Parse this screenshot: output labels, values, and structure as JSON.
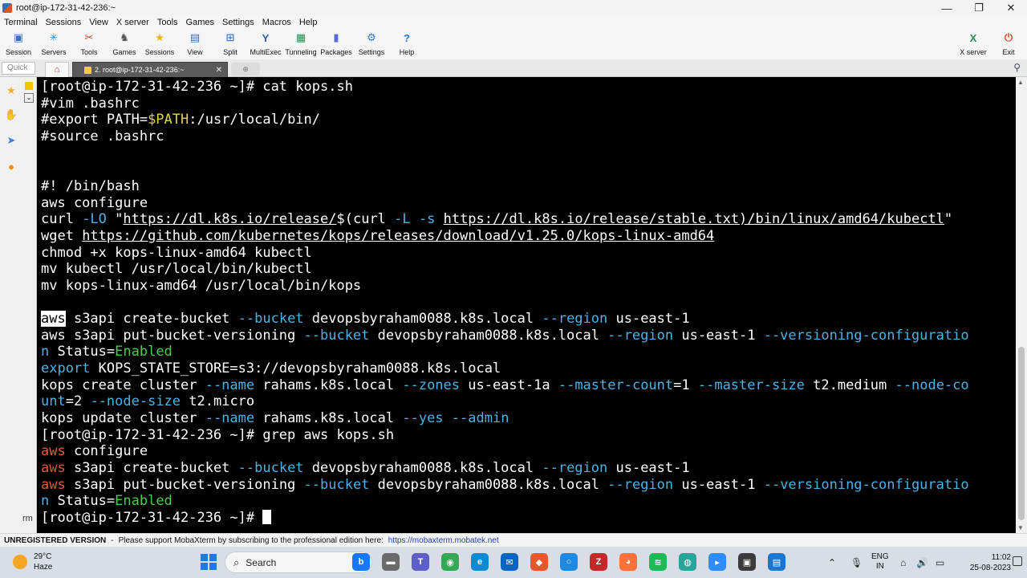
{
  "window": {
    "title": "root@ip-172-31-42-236:~",
    "controls": [
      "—",
      "❐",
      "✕"
    ]
  },
  "menu": [
    "Terminal",
    "Sessions",
    "View",
    "X server",
    "Tools",
    "Games",
    "Settings",
    "Macros",
    "Help"
  ],
  "toolbar": {
    "items": [
      {
        "label": "Session",
        "icon": "session-icon",
        "color": "#3a6fb5"
      },
      {
        "label": "Servers",
        "icon": "servers-icon",
        "color": "#2a8fd6"
      },
      {
        "label": "Tools",
        "icon": "tools-icon",
        "color": "#d9442a"
      },
      {
        "label": "Games",
        "icon": "games-icon",
        "color": "#555555"
      },
      {
        "label": "Sessions",
        "icon": "star-icon",
        "color": "#f2b01e"
      },
      {
        "label": "View",
        "icon": "view-icon",
        "color": "#3b6bb0"
      },
      {
        "label": "Split",
        "icon": "split-icon",
        "color": "#3d7fd1"
      },
      {
        "label": "MultiExec",
        "icon": "multiexec-icon",
        "color": "#2c5aa6"
      },
      {
        "label": "Tunneling",
        "icon": "tunneling-icon",
        "color": "#2e8b57"
      },
      {
        "label": "Packages",
        "icon": "packages-icon",
        "color": "#5b6cd6"
      },
      {
        "label": "Settings",
        "icon": "gear-icon",
        "color": "#2f7ad1"
      },
      {
        "label": "Help",
        "icon": "help-icon",
        "color": "#1e7be0"
      }
    ],
    "right": [
      {
        "label": "X server",
        "icon": "xserver-icon",
        "color": "#2e8b57"
      },
      {
        "label": "Exit",
        "icon": "power-icon",
        "color": "#d9442a"
      }
    ]
  },
  "tabs": {
    "quick": "Quick",
    "active": "2. root@ip-172-31-42-236:~",
    "close": "✕"
  },
  "sidebar": {
    "bottom_label": "rm"
  },
  "terminal": {
    "lines": [
      [
        {
          "t": "[root@ip-172-31-42-236 ~]# cat kops.sh"
        }
      ],
      [
        {
          "t": "#vim .bashrc"
        }
      ],
      [
        {
          "t": "#export PATH="
        },
        {
          "t": "$PATH",
          "c": "y"
        },
        {
          "t": ":/usr/local/bin/"
        }
      ],
      [
        {
          "t": "#source .bashrc"
        }
      ],
      [
        {
          "t": ""
        }
      ],
      [
        {
          "t": ""
        }
      ],
      [
        {
          "t": "#! /bin/bash"
        }
      ],
      [
        {
          "t": "aws configure"
        }
      ],
      [
        {
          "t": "curl "
        },
        {
          "t": "-LO",
          "c": "b"
        },
        {
          "t": " \""
        },
        {
          "t": "https://dl.k8s.io/release/",
          "c": "u"
        },
        {
          "t": "$(curl "
        },
        {
          "t": "-L -s",
          "c": "b"
        },
        {
          "t": " "
        },
        {
          "t": "https://dl.k8s.io/release/stable.txt)/bin/linux/amd64/kubectl",
          "c": "u"
        },
        {
          "t": "\""
        }
      ],
      [
        {
          "t": "wget "
        },
        {
          "t": "https://github.com/kubernetes/kops/releases/download/v1.25.0/kops-linux-amd64",
          "c": "u"
        }
      ],
      [
        {
          "t": "chmod +x kops-linux-amd64 kubectl"
        }
      ],
      [
        {
          "t": "mv kubectl /usr/local/bin/kubectl"
        }
      ],
      [
        {
          "t": "mv kops-linux-amd64 /usr/local/bin/kops"
        }
      ],
      [
        {
          "t": ""
        }
      ],
      [
        {
          "t": "aws",
          "c": "hl"
        },
        {
          "t": " s3api create-bucket "
        },
        {
          "t": "--bucket",
          "c": "b"
        },
        {
          "t": " devopsbyraham0088.k8s.local "
        },
        {
          "t": "--region",
          "c": "b"
        },
        {
          "t": " us-east-1"
        }
      ],
      [
        {
          "t": "aws s3api put-bucket-versioning "
        },
        {
          "t": "--bucket",
          "c": "b"
        },
        {
          "t": " devopsbyraham0088.k8s.local "
        },
        {
          "t": "--region",
          "c": "b"
        },
        {
          "t": " us-east-1 "
        },
        {
          "t": "--versioning-configuratio",
          "c": "b"
        }
      ],
      [
        {
          "t": "n",
          "c": "b"
        },
        {
          "t": " Status="
        },
        {
          "t": "Enabled",
          "c": "g"
        }
      ],
      [
        {
          "t": "export",
          "c": "b"
        },
        {
          "t": " KOPS_STATE_STORE=s3://devopsbyraham0088.k8s.local"
        }
      ],
      [
        {
          "t": "kops create cluster "
        },
        {
          "t": "--name",
          "c": "b"
        },
        {
          "t": " rahams.k8s.local "
        },
        {
          "t": "--zones",
          "c": "b"
        },
        {
          "t": " us-east-1a "
        },
        {
          "t": "--master-count",
          "c": "b"
        },
        {
          "t": "=1 "
        },
        {
          "t": "--master-size",
          "c": "b"
        },
        {
          "t": " t2.medium "
        },
        {
          "t": "--node-co",
          "c": "b"
        }
      ],
      [
        {
          "t": "unt",
          "c": "b"
        },
        {
          "t": "=2 "
        },
        {
          "t": "--node-size",
          "c": "b"
        },
        {
          "t": " t2.micro"
        }
      ],
      [
        {
          "t": "kops update cluster "
        },
        {
          "t": "--name",
          "c": "b"
        },
        {
          "t": " rahams.k8s.local "
        },
        {
          "t": "--yes",
          "c": "b"
        },
        {
          "t": " "
        },
        {
          "t": "--admin",
          "c": "b"
        }
      ],
      [
        {
          "t": "[root@ip-172-31-42-236 ~]# grep aws kops.sh"
        }
      ],
      [
        {
          "t": "aws",
          "c": "r"
        },
        {
          "t": " configure"
        }
      ],
      [
        {
          "t": "aws",
          "c": "r"
        },
        {
          "t": " s3api create-bucket "
        },
        {
          "t": "--bucket",
          "c": "b"
        },
        {
          "t": " devopsbyraham0088.k8s.local "
        },
        {
          "t": "--region",
          "c": "b"
        },
        {
          "t": " us-east-1"
        }
      ],
      [
        {
          "t": "aws",
          "c": "r"
        },
        {
          "t": " s3api put-bucket-versioning "
        },
        {
          "t": "--bucket",
          "c": "b"
        },
        {
          "t": " devopsbyraham0088.k8s.local "
        },
        {
          "t": "--region",
          "c": "b"
        },
        {
          "t": " us-east-1 "
        },
        {
          "t": "--versioning-configuratio",
          "c": "b"
        }
      ],
      [
        {
          "t": "n",
          "c": "b"
        },
        {
          "t": " Status="
        },
        {
          "t": "Enabled",
          "c": "g"
        }
      ],
      [
        {
          "t": "[root@ip-172-31-42-236 ~]# "
        },
        {
          "t": "",
          "c": "cursor"
        }
      ]
    ]
  },
  "statusbar": {
    "unregistered": "UNREGISTERED VERSION",
    "message": "Please support MobaXterm by subscribing to the professional edition here:",
    "link": "https://mobaxterm.mobatek.net"
  },
  "taskbar": {
    "temperature": "29°C",
    "weather": "Haze",
    "search_placeholder": "Search",
    "language_1": "ENG",
    "language_2": "IN",
    "time": "11:02",
    "date": "25-08-2023",
    "apps": [
      {
        "name": "bing-icon",
        "color": "#1677ff"
      },
      {
        "name": "file-explorer-icon",
        "color": "#6b6b6b"
      },
      {
        "name": "teams-icon",
        "color": "#5b5fc7"
      },
      {
        "name": "chrome-icon",
        "color": "#34a853"
      },
      {
        "name": "edge-icon",
        "color": "#0c8ad6"
      },
      {
        "name": "mail-icon",
        "color": "#0a64c2"
      },
      {
        "name": "git-icon",
        "color": "#e8572b"
      },
      {
        "name": "cortana-icon",
        "color": "#1e88e5"
      },
      {
        "name": "filezilla-icon",
        "color": "#c62828"
      },
      {
        "name": "firefox-icon",
        "color": "#ff7139"
      },
      {
        "name": "spotify-icon",
        "color": "#1db954"
      },
      {
        "name": "globe-icon",
        "color": "#26a69a"
      },
      {
        "name": "zoom-icon",
        "color": "#2d8cff"
      },
      {
        "name": "mobaxterm-icon",
        "color": "#3b3b3b"
      },
      {
        "name": "notepad-icon",
        "color": "#1976d2"
      }
    ]
  }
}
